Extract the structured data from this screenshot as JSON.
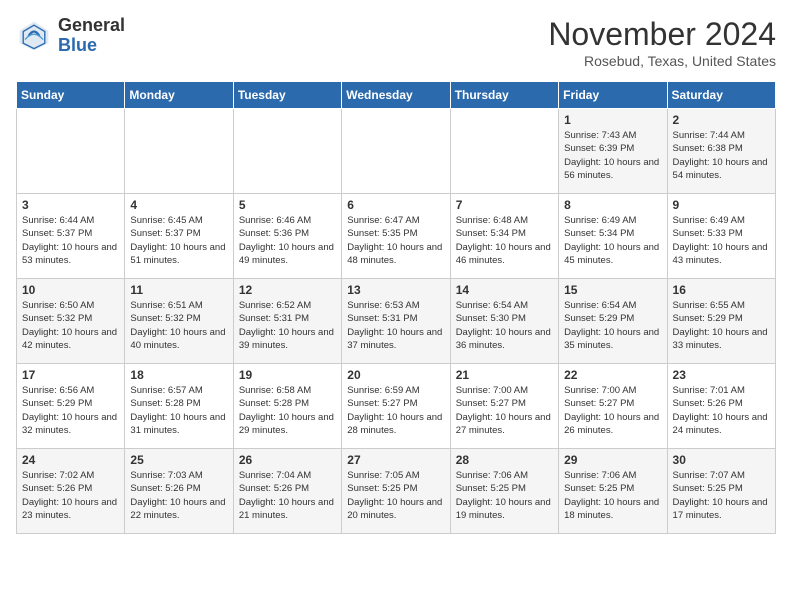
{
  "header": {
    "logo_general": "General",
    "logo_blue": "Blue",
    "month_title": "November 2024",
    "location": "Rosebud, Texas, United States"
  },
  "days_of_week": [
    "Sunday",
    "Monday",
    "Tuesday",
    "Wednesday",
    "Thursday",
    "Friday",
    "Saturday"
  ],
  "weeks": [
    [
      {
        "day": "",
        "info": ""
      },
      {
        "day": "",
        "info": ""
      },
      {
        "day": "",
        "info": ""
      },
      {
        "day": "",
        "info": ""
      },
      {
        "day": "",
        "info": ""
      },
      {
        "day": "1",
        "info": "Sunrise: 7:43 AM\nSunset: 6:39 PM\nDaylight: 10 hours and 56 minutes."
      },
      {
        "day": "2",
        "info": "Sunrise: 7:44 AM\nSunset: 6:38 PM\nDaylight: 10 hours and 54 minutes."
      }
    ],
    [
      {
        "day": "3",
        "info": "Sunrise: 6:44 AM\nSunset: 5:37 PM\nDaylight: 10 hours and 53 minutes."
      },
      {
        "day": "4",
        "info": "Sunrise: 6:45 AM\nSunset: 5:37 PM\nDaylight: 10 hours and 51 minutes."
      },
      {
        "day": "5",
        "info": "Sunrise: 6:46 AM\nSunset: 5:36 PM\nDaylight: 10 hours and 49 minutes."
      },
      {
        "day": "6",
        "info": "Sunrise: 6:47 AM\nSunset: 5:35 PM\nDaylight: 10 hours and 48 minutes."
      },
      {
        "day": "7",
        "info": "Sunrise: 6:48 AM\nSunset: 5:34 PM\nDaylight: 10 hours and 46 minutes."
      },
      {
        "day": "8",
        "info": "Sunrise: 6:49 AM\nSunset: 5:34 PM\nDaylight: 10 hours and 45 minutes."
      },
      {
        "day": "9",
        "info": "Sunrise: 6:49 AM\nSunset: 5:33 PM\nDaylight: 10 hours and 43 minutes."
      }
    ],
    [
      {
        "day": "10",
        "info": "Sunrise: 6:50 AM\nSunset: 5:32 PM\nDaylight: 10 hours and 42 minutes."
      },
      {
        "day": "11",
        "info": "Sunrise: 6:51 AM\nSunset: 5:32 PM\nDaylight: 10 hours and 40 minutes."
      },
      {
        "day": "12",
        "info": "Sunrise: 6:52 AM\nSunset: 5:31 PM\nDaylight: 10 hours and 39 minutes."
      },
      {
        "day": "13",
        "info": "Sunrise: 6:53 AM\nSunset: 5:31 PM\nDaylight: 10 hours and 37 minutes."
      },
      {
        "day": "14",
        "info": "Sunrise: 6:54 AM\nSunset: 5:30 PM\nDaylight: 10 hours and 36 minutes."
      },
      {
        "day": "15",
        "info": "Sunrise: 6:54 AM\nSunset: 5:29 PM\nDaylight: 10 hours and 35 minutes."
      },
      {
        "day": "16",
        "info": "Sunrise: 6:55 AM\nSunset: 5:29 PM\nDaylight: 10 hours and 33 minutes."
      }
    ],
    [
      {
        "day": "17",
        "info": "Sunrise: 6:56 AM\nSunset: 5:29 PM\nDaylight: 10 hours and 32 minutes."
      },
      {
        "day": "18",
        "info": "Sunrise: 6:57 AM\nSunset: 5:28 PM\nDaylight: 10 hours and 31 minutes."
      },
      {
        "day": "19",
        "info": "Sunrise: 6:58 AM\nSunset: 5:28 PM\nDaylight: 10 hours and 29 minutes."
      },
      {
        "day": "20",
        "info": "Sunrise: 6:59 AM\nSunset: 5:27 PM\nDaylight: 10 hours and 28 minutes."
      },
      {
        "day": "21",
        "info": "Sunrise: 7:00 AM\nSunset: 5:27 PM\nDaylight: 10 hours and 27 minutes."
      },
      {
        "day": "22",
        "info": "Sunrise: 7:00 AM\nSunset: 5:27 PM\nDaylight: 10 hours and 26 minutes."
      },
      {
        "day": "23",
        "info": "Sunrise: 7:01 AM\nSunset: 5:26 PM\nDaylight: 10 hours and 24 minutes."
      }
    ],
    [
      {
        "day": "24",
        "info": "Sunrise: 7:02 AM\nSunset: 5:26 PM\nDaylight: 10 hours and 23 minutes."
      },
      {
        "day": "25",
        "info": "Sunrise: 7:03 AM\nSunset: 5:26 PM\nDaylight: 10 hours and 22 minutes."
      },
      {
        "day": "26",
        "info": "Sunrise: 7:04 AM\nSunset: 5:26 PM\nDaylight: 10 hours and 21 minutes."
      },
      {
        "day": "27",
        "info": "Sunrise: 7:05 AM\nSunset: 5:25 PM\nDaylight: 10 hours and 20 minutes."
      },
      {
        "day": "28",
        "info": "Sunrise: 7:06 AM\nSunset: 5:25 PM\nDaylight: 10 hours and 19 minutes."
      },
      {
        "day": "29",
        "info": "Sunrise: 7:06 AM\nSunset: 5:25 PM\nDaylight: 10 hours and 18 minutes."
      },
      {
        "day": "30",
        "info": "Sunrise: 7:07 AM\nSunset: 5:25 PM\nDaylight: 10 hours and 17 minutes."
      }
    ]
  ]
}
